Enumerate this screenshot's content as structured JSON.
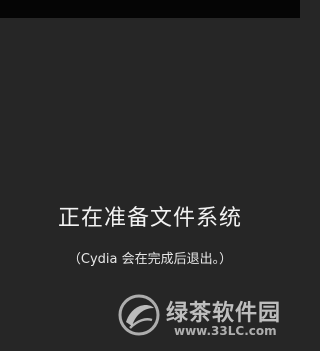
{
  "screen": {
    "title": "正在准备文件系统",
    "subtitle": "（Cydia 会在完成后退出。）"
  },
  "watermark": {
    "name": "绿茶软件园",
    "url": "www.33LC.com",
    "logo_icon": "leaf-swirl-logo-icon"
  },
  "colors": {
    "background": "#262626",
    "status_bar": "#050505",
    "text": "#f2f2f2"
  }
}
